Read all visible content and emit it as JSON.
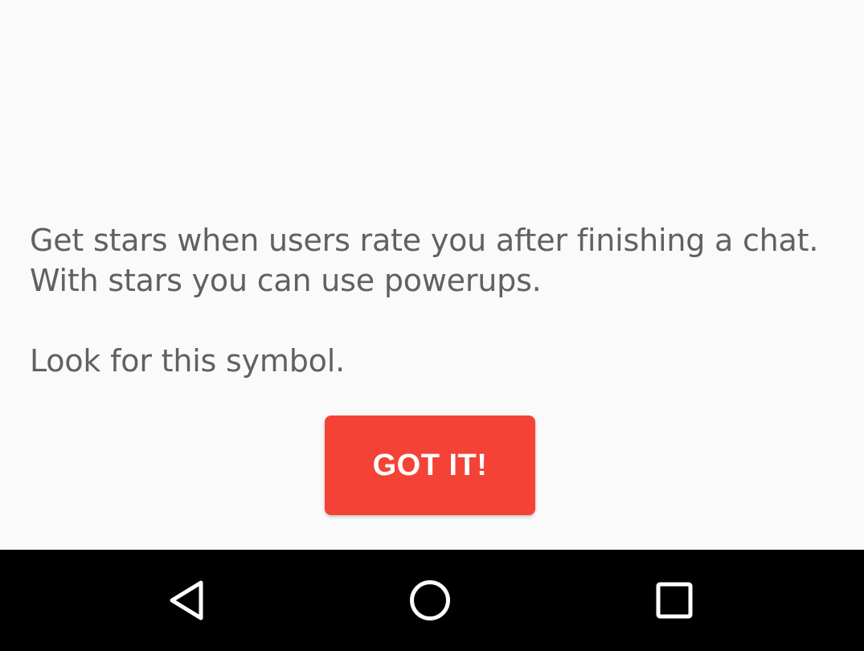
{
  "message": {
    "line1": "Get stars when users rate you after finishing a chat.",
    "line2": "With stars you can use powerups.",
    "line3": "Look for this symbol."
  },
  "got_it_button": {
    "label": "GOT IT!"
  },
  "nav_bar": {
    "back_icon": "back-triangle-icon",
    "home_icon": "home-circle-icon",
    "recents_icon": "recents-square-icon"
  },
  "colors": {
    "accent": "#f44336",
    "text": "#616161",
    "background": "#fafafa",
    "nav_bar": "#000000"
  }
}
